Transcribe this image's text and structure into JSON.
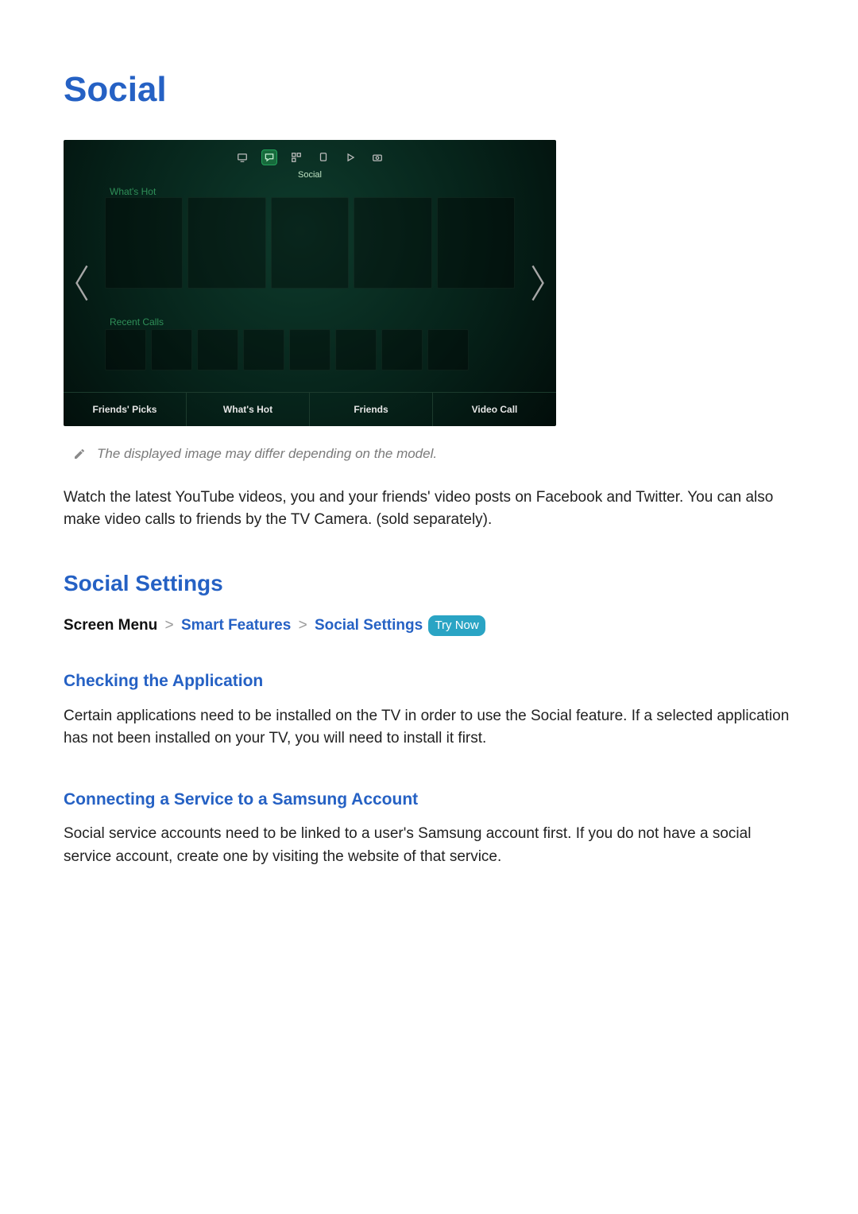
{
  "page": {
    "title": "Social",
    "note": "The displayed image may differ depending on the model.",
    "intro": "Watch the latest YouTube videos, you and your friends' video posts on Facebook and Twitter. You can also make video calls to friends by the TV Camera. (sold separately)."
  },
  "tv": {
    "topbar_active_label": "Social",
    "row1_label": "What's Hot",
    "row2_label": "Recent Calls",
    "tabs": [
      "Friends' Picks",
      "What's Hot",
      "Friends",
      "Video Call"
    ]
  },
  "settings": {
    "heading": "Social Settings",
    "breadcrumb": {
      "root": "Screen Menu",
      "l1": "Smart Features",
      "l2": "Social Settings",
      "pill": "Try Now"
    },
    "check": {
      "heading": "Checking the Application",
      "body": "Certain applications need to be installed on the TV in order to use the Social feature. If a selected application has not been installed on your TV, you will need to install it first."
    },
    "connect": {
      "heading": "Connecting a Service to a Samsung Account",
      "body": "Social service accounts need to be linked to a user's Samsung account first. If you do not have a social service account, create one by visiting the website of that service."
    }
  }
}
